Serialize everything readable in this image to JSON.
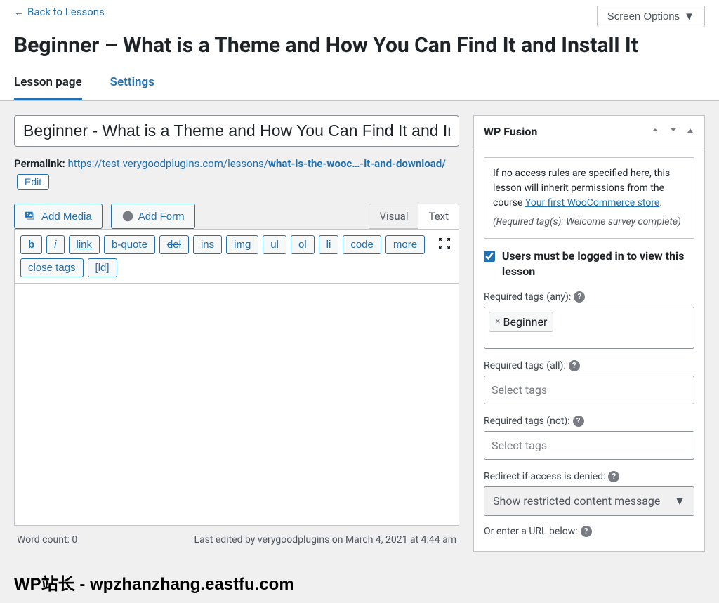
{
  "back_link": "Back to Lessons",
  "screen_options": "Screen Options",
  "page_title": "Beginner – What is a Theme and How You Can Find It and Install It",
  "tabs": {
    "lesson": "Lesson page",
    "settings": "Settings"
  },
  "title_input": "Beginner - What is a Theme and How You Can Find It and Install It",
  "permalink": {
    "label": "Permalink:",
    "base": "https://test.verygoodplugins.com/lessons/",
    "slug": "what-is-the-wooc…-it-and-download/",
    "edit": "Edit"
  },
  "media": {
    "add_media": "Add Media",
    "add_form": "Add Form"
  },
  "editor_tabs": {
    "visual": "Visual",
    "text": "Text"
  },
  "quicktags": [
    "b",
    "i",
    "link",
    "b-quote",
    "del",
    "ins",
    "img",
    "ul",
    "ol",
    "li",
    "code",
    "more",
    "close tags",
    "[ld]"
  ],
  "footer": {
    "word_count_label": "Word count:",
    "word_count": "0",
    "last_edited": "Last edited by verygoodplugins on March 4, 2021 at 4:44 am"
  },
  "metabox": {
    "title": "WP Fusion",
    "info_text_pre": "If no access rules are specified here, this lesson will inherit permissions from the course ",
    "info_link": "Your first WooCommerce store",
    "required_tags_note": "(Required tag(s): Welcome survey complete)",
    "checkbox_label": "Users must be logged in to view this lesson",
    "labels": {
      "required_any": "Required tags (any):",
      "required_all": "Required tags (all):",
      "required_not": "Required tags (not):",
      "redirect": "Redirect if access is denied:",
      "url_below": "Or enter a URL below:"
    },
    "tag_any": "Beginner",
    "placeholder": "Select tags",
    "redirect_value": "Show restricted content message"
  },
  "watermark": "WP站长 - wpzhanzhang.eastfu.com"
}
